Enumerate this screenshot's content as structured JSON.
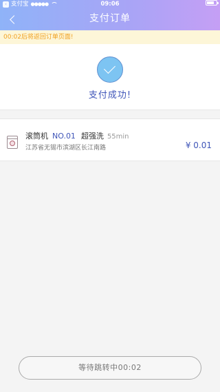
{
  "status_bar": {
    "back_app": "支付宝",
    "signal": "●●●●●",
    "time": "09:06",
    "battery_level": 0.8
  },
  "header": {
    "title": "支付订单"
  },
  "notice": {
    "text": "00:02后将返回订单页面!"
  },
  "success": {
    "text": "支付成功!"
  },
  "order": {
    "machine_name": "滚筒机",
    "machine_no": "NO.01",
    "wash_mode": "超强洗",
    "duration": "55min",
    "address": "江苏省无锡市滨湖区长江南路",
    "price": "¥ 0.01"
  },
  "footer": {
    "button_label": "等待跳转中00:02"
  },
  "colors": {
    "accent": "#3f55b8",
    "notice_text": "#f0a020",
    "notice_bg": "#fdf6d8",
    "check_fill": "#7dc4f2"
  },
  "icons": [
    "back-icon",
    "wifi-icon",
    "battery-icon",
    "check-icon",
    "washing-machine-icon"
  ]
}
